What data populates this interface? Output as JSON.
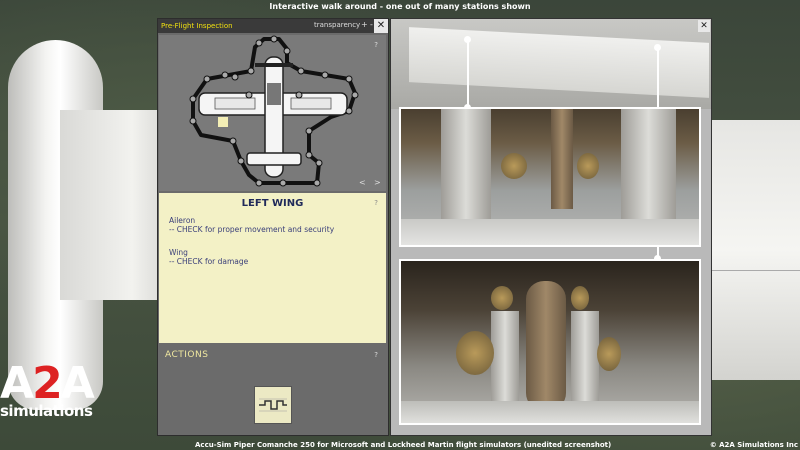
{
  "header": {
    "caption": "Interactive walk around - one out of many stations shown"
  },
  "footer": {
    "caption": "Accu-Sim Piper Comanche 250 for Microsoft and Lockheed Martin flight simulators (unedited screenshot)",
    "copyright": "© A2A Simulations Inc"
  },
  "logo": {
    "main_a": "A",
    "main_2": "2",
    "main_b": "A",
    "sub": "simulations"
  },
  "inspection_panel": {
    "title": "Pre-Flight Inspection",
    "transparency_label": "transparency",
    "plus": "+",
    "minus": "-",
    "close": "✕",
    "help": "?",
    "prev": "<",
    "next": ">",
    "section_title": "LEFT WING",
    "items": [
      {
        "heading": "Aileron",
        "line": "-- CHECK for proper movement and security"
      },
      {
        "heading": "Wing",
        "line": "-- CHECK for damage"
      }
    ],
    "actions_label": "ACTIONS"
  },
  "photo_window": {
    "close": "✕"
  }
}
